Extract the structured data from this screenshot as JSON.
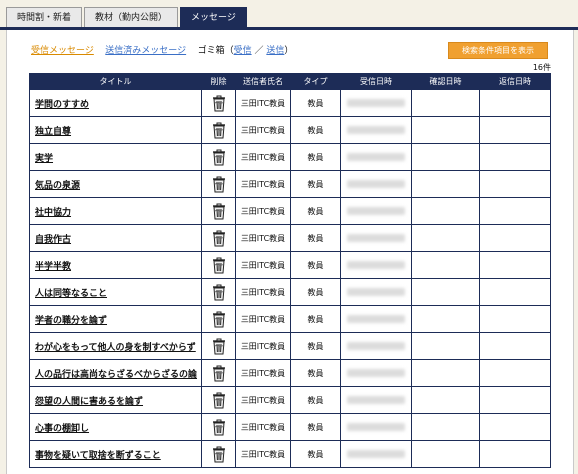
{
  "tabs": [
    {
      "label": "時間割・新着"
    },
    {
      "label": "教材（勤内公開）"
    },
    {
      "label": "メッセージ"
    }
  ],
  "subnav": {
    "received": "受信メッセージ",
    "sent": "送信済みメッセージ",
    "trash_prefix": "ゴミ箱（",
    "trash_received": "受信",
    "separator": "／",
    "trash_sent": "送信",
    "trash_suffix": "）"
  },
  "search_button": "検索条件項目を表示",
  "count": "16件",
  "columns": [
    "タイトル",
    "削除",
    "送信者氏名",
    "タイプ",
    "受信日時",
    "確認日時",
    "返信日時"
  ],
  "rows": [
    {
      "title": "学問のすすめ",
      "sender": "三田ITC教員",
      "type": "教員"
    },
    {
      "title": "独立自尊",
      "sender": "三田ITC教員",
      "type": "教員"
    },
    {
      "title": "実学",
      "sender": "三田ITC教員",
      "type": "教員"
    },
    {
      "title": "気品の泉源",
      "sender": "三田ITC教員",
      "type": "教員"
    },
    {
      "title": "社中協力",
      "sender": "三田ITC教員",
      "type": "教員"
    },
    {
      "title": "自我作古",
      "sender": "三田ITC教員",
      "type": "教員"
    },
    {
      "title": "半学半教",
      "sender": "三田ITC教員",
      "type": "教員"
    },
    {
      "title": "人は同等なること",
      "sender": "三田ITC教員",
      "type": "教員"
    },
    {
      "title": "学者の職分を論ず",
      "sender": "三田ITC教員",
      "type": "教員"
    },
    {
      "title": "わが心をもって他人の身を制すべからず",
      "sender": "三田ITC教員",
      "type": "教員"
    },
    {
      "title": "人の品行は高尚ならざるべからざるの論",
      "sender": "三田ITC教員",
      "type": "教員"
    },
    {
      "title": "怨望の人間に害あるを論ず",
      "sender": "三田ITC教員",
      "type": "教員"
    },
    {
      "title": "心事の棚卸し",
      "sender": "三田ITC教員",
      "type": "教員"
    },
    {
      "title": "事物を疑いて取捨を断ずること",
      "sender": "三田ITC教員",
      "type": "教員"
    }
  ],
  "icons": {
    "delete": "trash-icon"
  }
}
